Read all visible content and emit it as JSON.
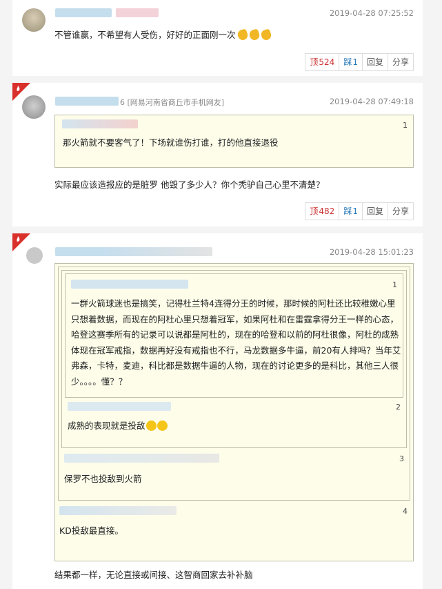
{
  "comments": [
    {
      "time": "2019-04-28 07:25:52",
      "text": "不管谁赢，不希望有人受伤，好好的正面刚一次",
      "emojis": [
        "clap-icon",
        "clap-icon",
        "clap-icon"
      ],
      "actions": {
        "up_label": "顶",
        "up_count": "524",
        "down_label": "踩",
        "down_count": "1",
        "reply": "回复",
        "share": "分享"
      }
    },
    {
      "time": "2019-04-28 07:49:18",
      "user_source_fragment": "6 [网易河南省商丘市手机网友]",
      "quotes": [
        {
          "index": "1",
          "text": "那火箭就不要客气了！下场就谁伤打谁，打的他直接退役"
        }
      ],
      "text": "实际最应该造报应的是脏罗  他毁了多少人？你个秃驴自己心里不清楚？",
      "actions": {
        "up_label": "顶",
        "up_count": "482",
        "down_label": "踩",
        "down_count": "1",
        "reply": "回复",
        "share": "分享"
      }
    },
    {
      "time": "2019-04-28 15:01:23",
      "quotes": [
        {
          "index": "1",
          "lines": [
            "一群火箭球迷也是搞笑，记得杜兰特4连得分王的时候，那时候的阿杜还比较稚嫩心里",
            "只想着数据，而现在的阿杜心里只想着冠军，如果阿杜和在雷霆拿得分王一样的心态，",
            "哈登这赛季所有的记录可以说都是阿杜的，现在的哈登和以前的阿杜很像，阿杜的成熟",
            "体现在冠军戒指，数据再好没有戒指也不行，马龙数据多牛逼，前20有人排吗？当年艾",
            "弗森，卡特，麦迪，科比都是数据牛逼的人物，现在的讨论更多的是科比，其他三人很",
            "少。。。。懂？？"
          ]
        },
        {
          "index": "2",
          "text": "成熟的表现就是投敌",
          "emojis": [
            "laughing-face-icon",
            "laughing-face-icon"
          ]
        },
        {
          "index": "3",
          "text": "保罗不也投敌到火箭"
        },
        {
          "index": "4",
          "text": "KD投敌最直接。"
        }
      ],
      "text": "结果都一样，无论直接或间接、这智商回家去补补脑"
    }
  ]
}
